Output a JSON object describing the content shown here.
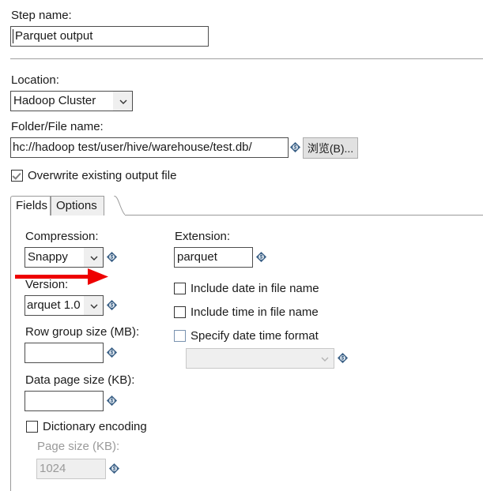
{
  "step": {
    "label": "Step name:",
    "value": "Parquet output"
  },
  "location": {
    "label": "Location:",
    "value": "Hadoop Cluster"
  },
  "folder": {
    "label": "Folder/File name:",
    "value": "hc://hadoop test/user/hive/warehouse/test.db/",
    "browse_label": "浏览(B)..."
  },
  "overwrite": {
    "label": "Overwrite existing output file",
    "checked": true
  },
  "tabs": [
    {
      "label": "Fields",
      "selected": false
    },
    {
      "label": "Options",
      "selected": true
    }
  ],
  "options": {
    "compression": {
      "label": "Compression:",
      "value": "Snappy"
    },
    "version": {
      "label": "Version:",
      "value": "arquet 1.0"
    },
    "row_group_size": {
      "label": "Row group size (MB):",
      "value": ""
    },
    "data_page_size": {
      "label": "Data page size (KB):",
      "value": ""
    },
    "dictionary_encoding": {
      "label": "Dictionary encoding",
      "checked": false
    },
    "page_size": {
      "label": "Page size (KB):",
      "value": "1024",
      "disabled": true
    },
    "extension": {
      "label": "Extension:",
      "value": "parquet"
    },
    "include_date": {
      "label": "Include date in file name",
      "checked": false
    },
    "include_time": {
      "label": "Include time in file name",
      "checked": false
    },
    "specify_date_time_format": {
      "label": "Specify date time format",
      "checked": false
    },
    "date_time_format": {
      "value": "",
      "disabled": true
    }
  },
  "colors": {
    "variable_icon": "#3d6287",
    "annotation_arrow": "#ee0000",
    "field_border": "#4d4d4d",
    "disabled_text": "#9a9a9a"
  }
}
